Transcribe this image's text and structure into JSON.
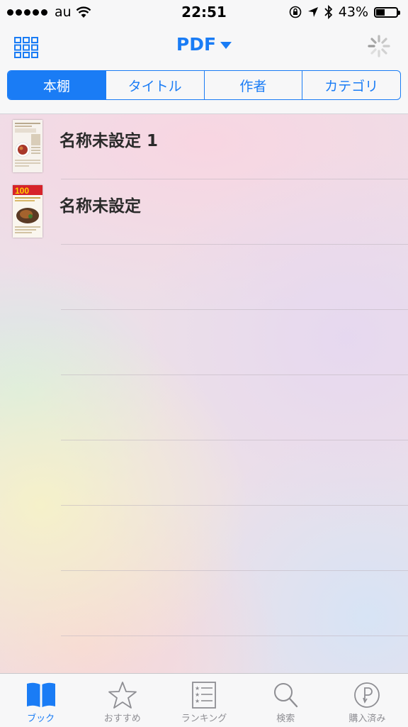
{
  "status_bar": {
    "carrier": "au",
    "time": "22:51",
    "battery": "43%",
    "battery_level": 0.43
  },
  "nav": {
    "title": "PDF"
  },
  "segments": {
    "items": [
      "本棚",
      "タイトル",
      "作者",
      "カテゴリ"
    ],
    "selected": "本棚"
  },
  "books": [
    {
      "title": "名称未設定 1",
      "thumb_icon": "recipe-magazine-cover-icon"
    },
    {
      "title": "名称未設定",
      "thumb_icon": "recipe-100-cover-icon"
    }
  ],
  "tabs": [
    {
      "label": "ブック",
      "icon": "open-book-icon",
      "active": true
    },
    {
      "label": "おすすめ",
      "icon": "star-icon",
      "active": false
    },
    {
      "label": "ランキング",
      "icon": "ranking-list-icon",
      "active": false
    },
    {
      "label": "検索",
      "icon": "search-icon",
      "active": false
    },
    {
      "label": "購入済み",
      "icon": "purchased-icon",
      "active": false
    }
  ],
  "colors": {
    "accent": "#1a7cf5",
    "inactive": "#8e8e93"
  }
}
